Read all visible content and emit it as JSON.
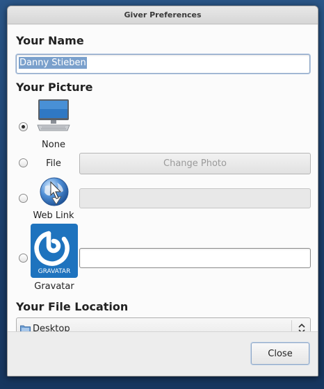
{
  "window": {
    "title": "Giver Preferences"
  },
  "name_section": {
    "title": "Your Name",
    "value": "Danny Stieben"
  },
  "picture_section": {
    "title": "Your Picture",
    "options": [
      {
        "label": "None",
        "icon": "computer-monitor-icon",
        "selected": true
      },
      {
        "label": "File",
        "selected": false,
        "button_label": "Change Photo"
      },
      {
        "label": "Web Link",
        "icon": "web-globe-icon",
        "selected": false,
        "value": ""
      },
      {
        "label": "Gravatar",
        "icon": "gravatar-logo-icon",
        "selected": false,
        "value": ""
      }
    ]
  },
  "location_section": {
    "title": "Your File Location",
    "selected": "Desktop",
    "icon": "folder-icon"
  },
  "footer": {
    "close_label": "Close"
  },
  "colors": {
    "selection": "#7aa0cc",
    "gravatar_blue": "#1e73be",
    "focus_border": "#8fa8c8"
  }
}
